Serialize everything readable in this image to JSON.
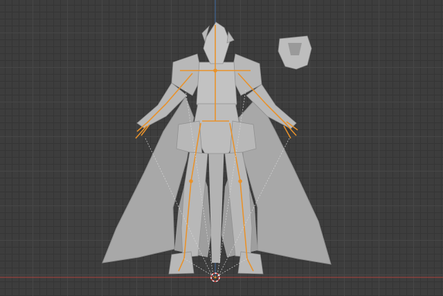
{
  "app": "3D viewport",
  "viewport": {
    "view": "front-orthographic",
    "grid": true,
    "background_color": "#3d3d3d",
    "grid_color": "#474747"
  },
  "axes": {
    "x_axis_color": "#b0433d",
    "z_axis_color": "#3f6ca3"
  },
  "scene_objects": [
    {
      "name": "armored-character-mesh",
      "color": "#b5b5b5",
      "selected": false
    },
    {
      "name": "cape-mesh",
      "color": "#a8a8a8",
      "selected": false
    },
    {
      "name": "detached-helmet-mesh",
      "color": "#bdbdbd",
      "selected": false
    },
    {
      "name": "armature-rig",
      "color": "#e8922b",
      "selected": true
    }
  ],
  "cursor": {
    "name": "3d-cursor",
    "colors": [
      "#e04040",
      "#ffffff"
    ]
  }
}
